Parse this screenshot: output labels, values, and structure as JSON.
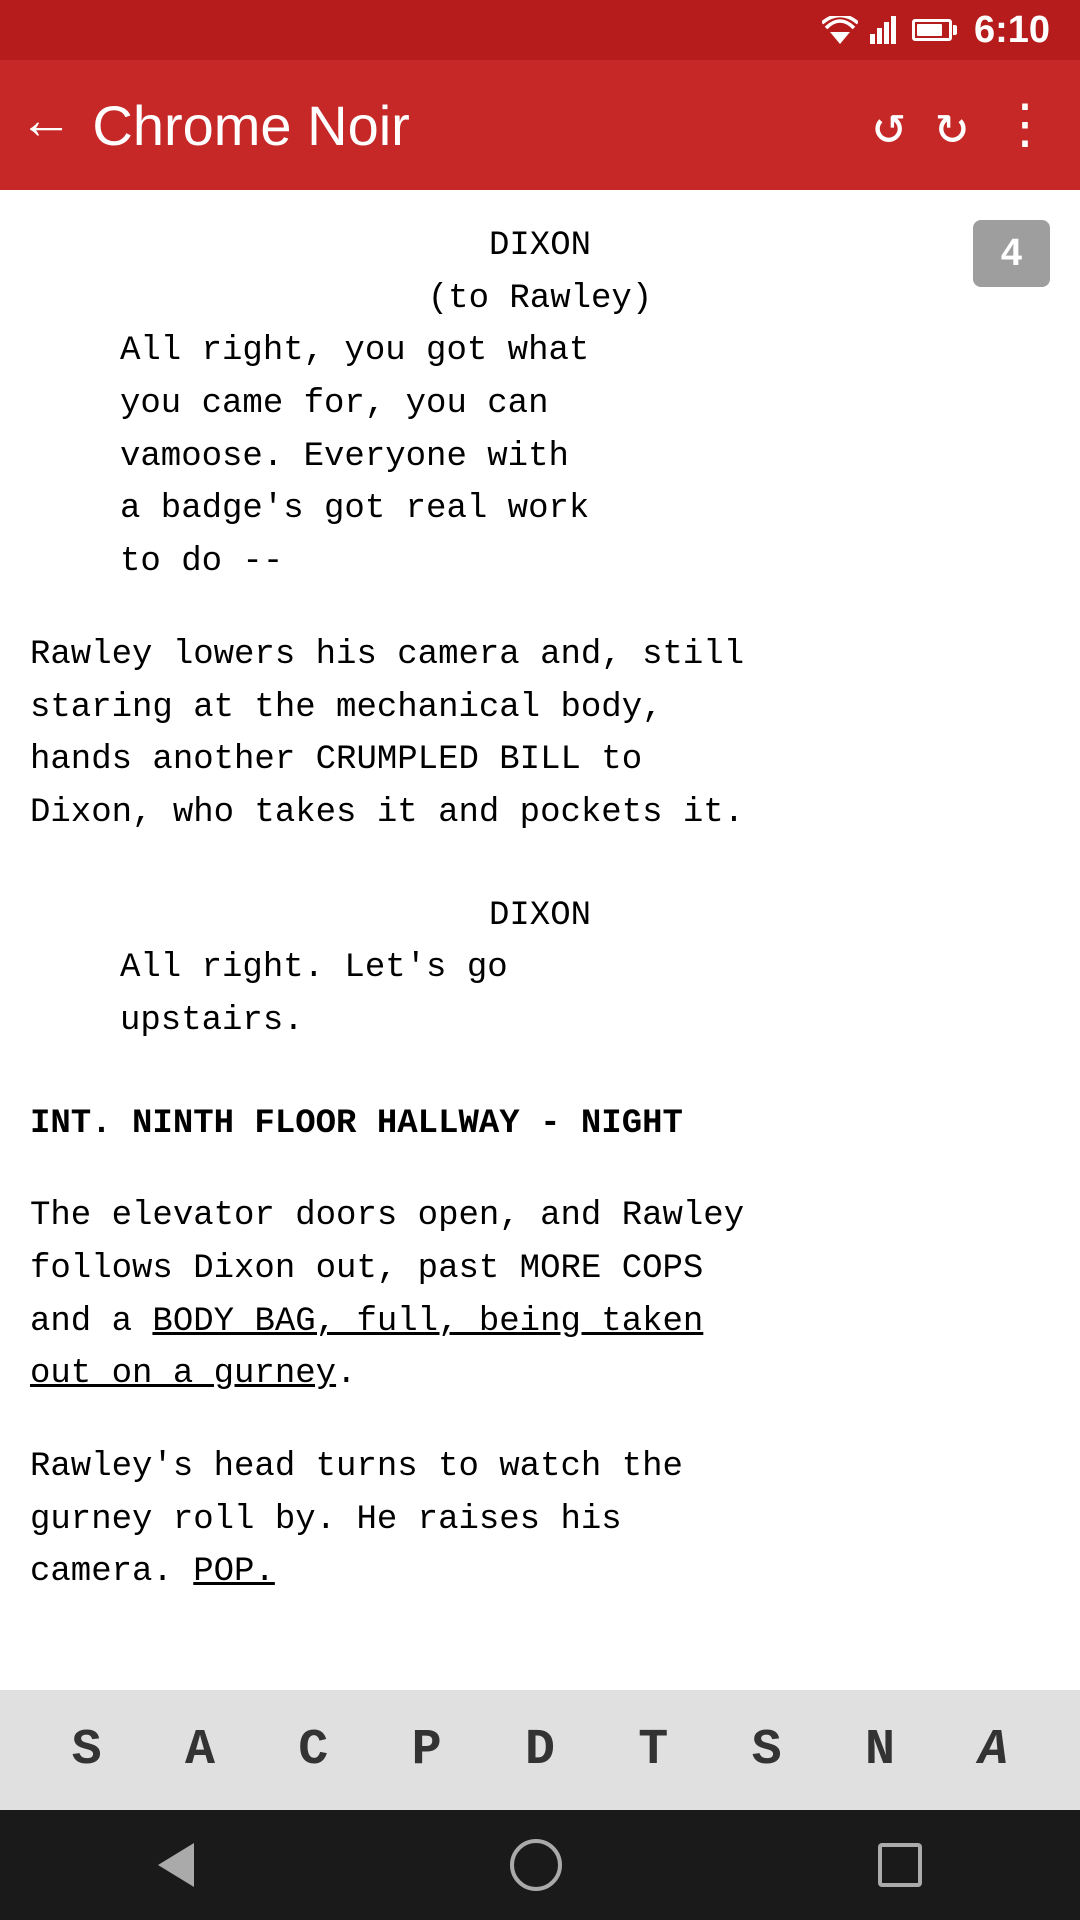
{
  "statusBar": {
    "time": "6:10"
  },
  "appBar": {
    "title": "Chrome Noir",
    "backLabel": "←",
    "undoLabel": "↺",
    "redoLabel": "↻",
    "moreLabel": "⋮"
  },
  "pageNumber": "4",
  "script": {
    "blocks": [
      {
        "type": "character",
        "text": "DIXON"
      },
      {
        "type": "parenthetical",
        "text": "(to Rawley)"
      },
      {
        "type": "dialogue",
        "text": "All right, you got what you came for, you can vamoose. Everyone with a badge's got real work to do --"
      },
      {
        "type": "action",
        "text": "Rawley lowers his camera and, still staring at the mechanical body, hands another CRUMPLED BILL to Dixon, who takes it and pockets it."
      },
      {
        "type": "character",
        "text": "DIXON"
      },
      {
        "type": "dialogue",
        "text": "All right. Let's go upstairs."
      },
      {
        "type": "scene-heading",
        "text": "INT. NINTH FLOOR HALLWAY - NIGHT"
      },
      {
        "type": "action",
        "text": "The elevator doors open, and Rawley follows Dixon out, past MORE COPS and a BODY BAG, full, being taken out on a gurney.",
        "underlineStart": 116,
        "underlineText": "BODY BAG, full, being taken out on a gurney"
      },
      {
        "type": "action",
        "text": "Rawley's head turns to watch the gurney roll by. He raises his camera. POP.",
        "underlineText": "POP."
      }
    ]
  },
  "toolbar": {
    "buttons": [
      {
        "label": "S",
        "name": "scene-heading-button"
      },
      {
        "label": "A",
        "name": "action-button"
      },
      {
        "label": "C",
        "name": "character-button"
      },
      {
        "label": "P",
        "name": "parenthetical-button"
      },
      {
        "label": "D",
        "name": "dialogue-button"
      },
      {
        "label": "T",
        "name": "transition-button"
      },
      {
        "label": "S",
        "name": "shot-button"
      },
      {
        "label": "N",
        "name": "note-button"
      },
      {
        "label": "A",
        "name": "action2-button",
        "italic": true
      }
    ]
  }
}
